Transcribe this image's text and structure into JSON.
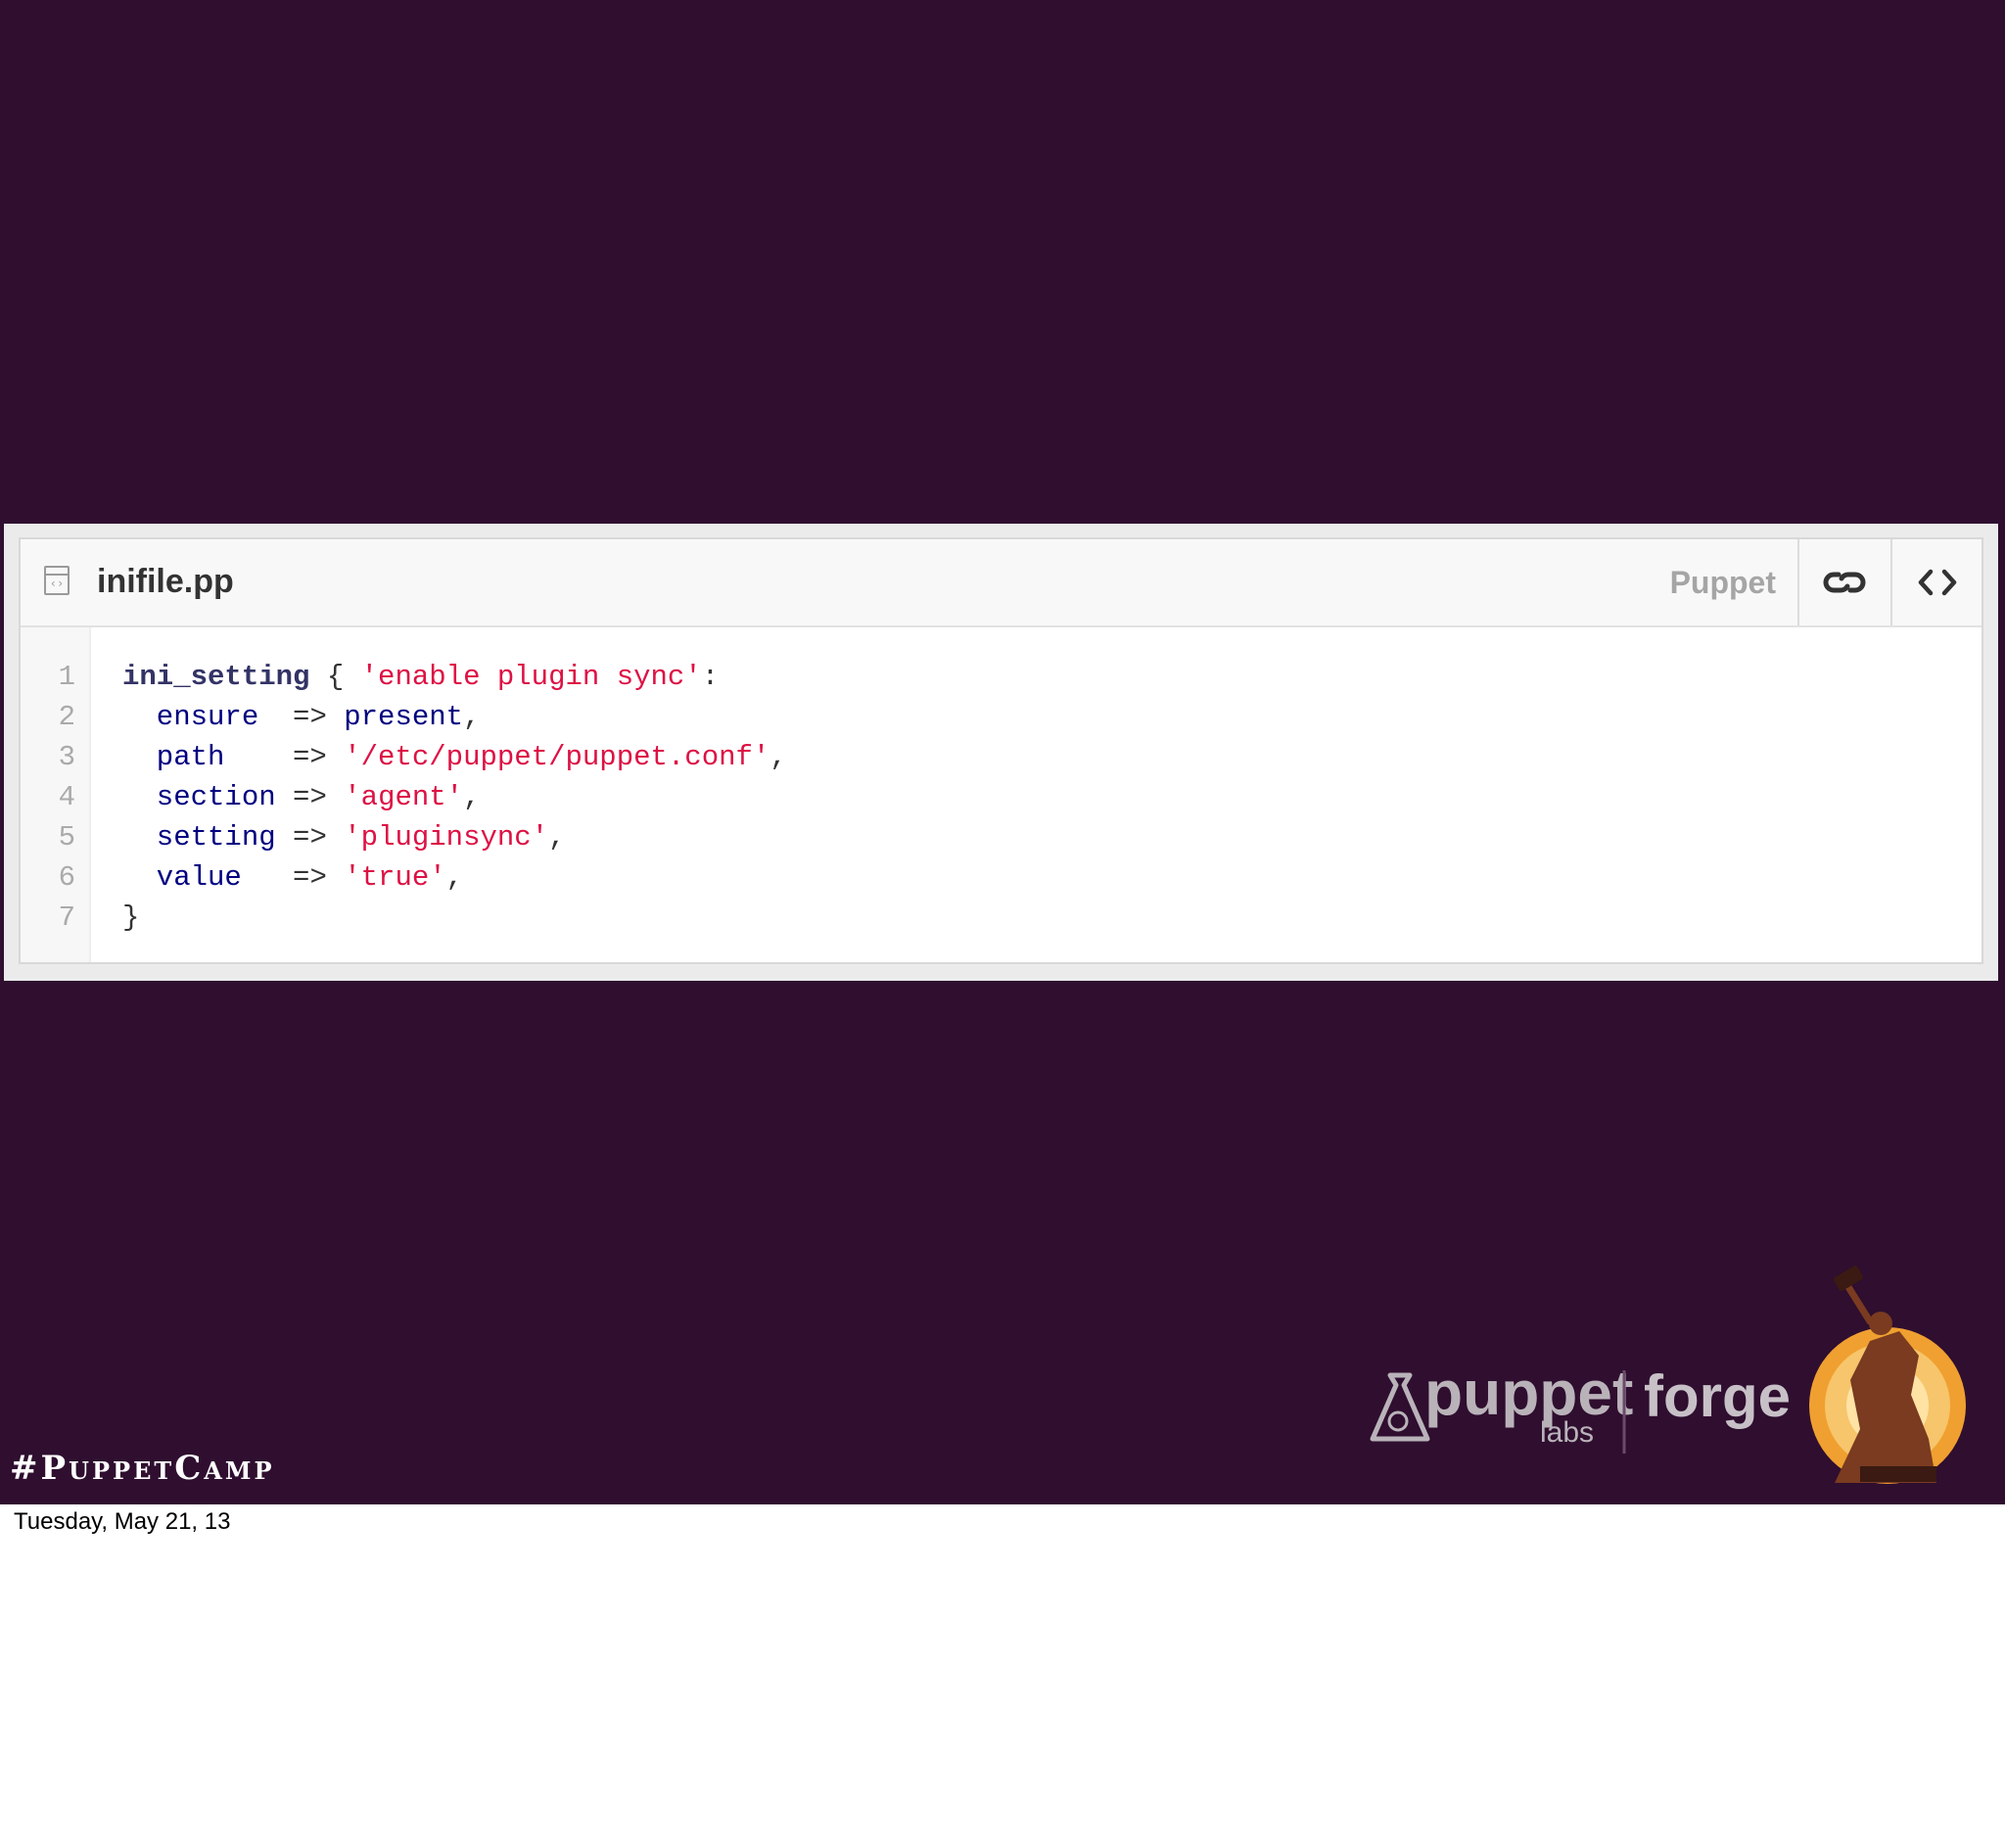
{
  "gist": {
    "file_icon": "file-code-icon",
    "file_name": "inifile.pp",
    "language": "Puppet",
    "link_icon": "link-icon",
    "raw_icon": "code-icon",
    "line_numbers": [
      "1",
      "2",
      "3",
      "4",
      "5",
      "6",
      "7"
    ],
    "code_lines": [
      [
        "ini_setting",
        " { ",
        "'enable plugin sync'",
        ":"
      ],
      [
        "  ensure",
        "  => ",
        "present",
        ","
      ],
      [
        "  path",
        "    => ",
        "'/etc/puppet/puppet.conf'",
        ","
      ],
      [
        "  section",
        " => ",
        "'agent'",
        ","
      ],
      [
        "  setting",
        " => ",
        "'pluginsync'",
        ","
      ],
      [
        "  value",
        "   => ",
        "'true'",
        ","
      ],
      [
        "}",
        "",
        "",
        ""
      ]
    ]
  },
  "branding": {
    "puppet_word": "puppet",
    "labs_word": "labs",
    "forge_word": "forge",
    "hashtag": "#PuppetCamp",
    "accent_color": "#f0a030",
    "background_color": "#2f0e2f"
  },
  "footer": {
    "date": "Tuesday, May 21, 13"
  }
}
